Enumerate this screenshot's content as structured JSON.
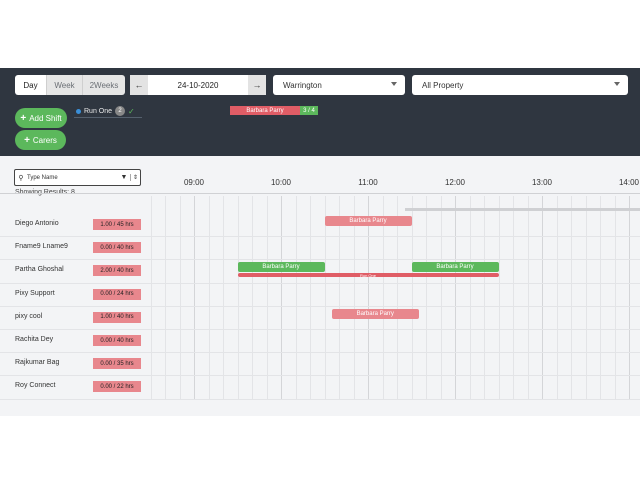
{
  "toolbar": {
    "view_tabs": [
      {
        "label": "Day",
        "active": true
      },
      {
        "label": "Week",
        "active": false
      },
      {
        "label": "2Weeks",
        "active": false
      }
    ],
    "date": "24-10-2020",
    "location_select": "Warrington",
    "property_select": "All Property"
  },
  "actions": {
    "add_shift": "Add Shift",
    "carers": "Carers"
  },
  "run_summary": {
    "label": "Run One",
    "count": "2"
  },
  "unassigned_shift": {
    "name": "Barbara Parry",
    "ratio": "3 / 4"
  },
  "search": {
    "placeholder": "Type Name",
    "results_text": "Showing Results: 8"
  },
  "timeline": {
    "hours": [
      "09:00",
      "10:00",
      "11:00",
      "12:00",
      "13:00",
      "14:00"
    ]
  },
  "staff": [
    {
      "name": "Diego Antonio",
      "hours": "1.00 / 45 hrs"
    },
    {
      "name": "Fname9 Lname9",
      "hours": "0.00 / 40 hrs"
    },
    {
      "name": "Partha Ghoshal",
      "hours": "2.00 / 40 hrs"
    },
    {
      "name": "Pixy Support",
      "hours": "0.00 / 24 hrs"
    },
    {
      "name": "pixy cool",
      "hours": "1.00 / 40 hrs"
    },
    {
      "name": "Rachita Dey",
      "hours": "0.00 / 40 hrs"
    },
    {
      "name": "Rajkumar Bag",
      "hours": "0.00 / 35 hrs"
    },
    {
      "name": "Roy Connect",
      "hours": "0.00 / 22 hrs"
    }
  ],
  "shifts": [
    {
      "row": 0,
      "label": "Barbara Parry",
      "start": "10:30",
      "end": "11:30",
      "status": "unassigned"
    },
    {
      "row": 2,
      "label": "Barbara Parry",
      "start": "09:30",
      "end": "10:30",
      "status": "assigned"
    },
    {
      "row": 2,
      "label": "Barbara Parry",
      "start": "11:30",
      "end": "12:30",
      "status": "assigned"
    },
    {
      "row": 4,
      "label": "Barbara Parry",
      "start": "10:35",
      "end": "11:35",
      "status": "unassigned"
    }
  ],
  "runs": [
    {
      "row": 2,
      "label": "Run One",
      "start": "09:30",
      "end": "12:30"
    }
  ],
  "colors": {
    "header_bg": "#2f3640",
    "green": "#5cb85c",
    "red": "#e05d66",
    "pink": "#e8878d"
  }
}
